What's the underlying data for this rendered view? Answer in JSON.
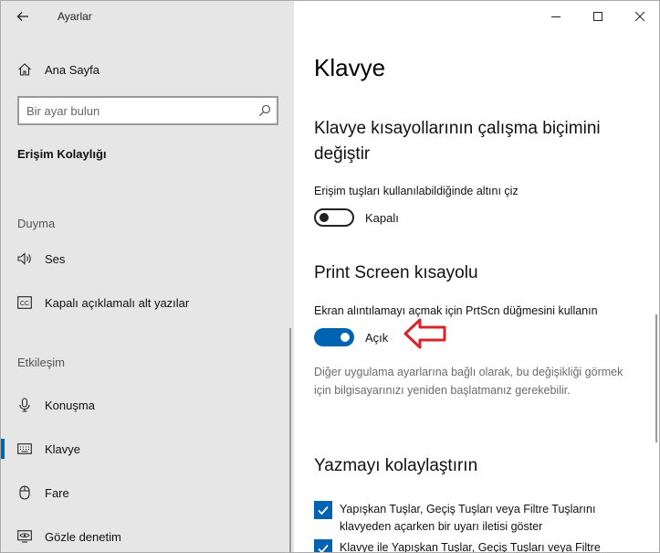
{
  "window": {
    "title": "Ayarlar"
  },
  "sidebar": {
    "home_label": "Ana Sayfa",
    "search_placeholder": "Bir ayar bulun",
    "section_title": "Erişim Kolaylığı",
    "groups": [
      {
        "header": "Duyma",
        "items": [
          {
            "label": "Ses",
            "icon": "speaker-icon"
          },
          {
            "label": "Kapalı açıklamalı alt yazılar",
            "icon": "closed-captions-icon"
          }
        ]
      },
      {
        "header": "Etkileşim",
        "items": [
          {
            "label": "Konuşma",
            "icon": "microphone-icon"
          },
          {
            "label": "Klavye",
            "icon": "keyboard-icon",
            "selected": true
          },
          {
            "label": "Fare",
            "icon": "mouse-icon"
          },
          {
            "label": "Gözle denetim",
            "icon": "eye-control-icon"
          }
        ]
      }
    ]
  },
  "main": {
    "page_title": "Klavye",
    "shortcuts_heading": "Klavye kısayollarının çalışma biçimini değiştir",
    "underline_label": "Erişim tuşları kullanılabildiğinde altını çiz",
    "underline_toggle": {
      "state": "off",
      "label": "Kapalı"
    },
    "printscreen_heading": "Print Screen kısayolu",
    "printscreen_label": "Ekran alıntılamayı açmak için PrtScn düğmesini kullanın",
    "printscreen_toggle": {
      "state": "on",
      "label": "Açık"
    },
    "printscreen_note": "Diğer uygulama ayarlarına bağlı olarak, bu değişikliği görmek için bilgisayarınızı yeniden başlatmanız gerekebilir.",
    "typing_heading": "Yazmayı kolaylaştırın",
    "checkboxes": [
      {
        "label": "Yapışkan Tuşlar, Geçiş Tuşları veya Filtre Tuşlarını klavyeden açarken bir uyarı iletisi göster",
        "checked": true
      },
      {
        "label": "Klavye ile Yapışkan Tuşlar, Geçiş Tuşları veya Filtre",
        "checked": true
      }
    ]
  },
  "colors": {
    "accent": "#0063b1",
    "sidebar_bg": "#e6e6e6",
    "arrow": "#d9232a"
  }
}
